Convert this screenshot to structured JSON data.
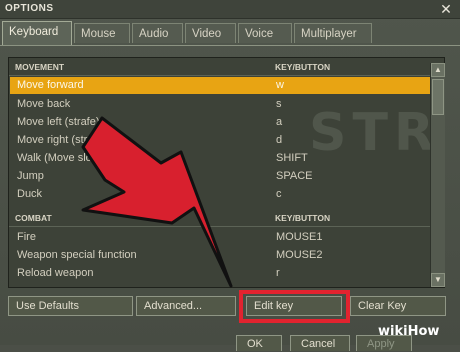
{
  "window": {
    "title": "OPTIONS",
    "close_glyph": "✕"
  },
  "tabs": [
    {
      "label": "Keyboard",
      "active": true
    },
    {
      "label": "Mouse"
    },
    {
      "label": "Audio"
    },
    {
      "label": "Video"
    },
    {
      "label": "Voice"
    },
    {
      "label": "Multiplayer"
    }
  ],
  "background_logo": "STRIK",
  "sections": {
    "movement": {
      "header_action": "MOVEMENT",
      "header_key": "KEY/BUTTON",
      "rows": [
        {
          "action": "Move forward",
          "key": "w",
          "selected": true
        },
        {
          "action": "Move back",
          "key": "s"
        },
        {
          "action": "Move left (strafe)",
          "key": "a"
        },
        {
          "action": "Move right (strafe)",
          "key": "d"
        },
        {
          "action": "Walk (Move slowly)",
          "key": "SHIFT"
        },
        {
          "action": "Jump",
          "key": "SPACE"
        },
        {
          "action": "Duck",
          "key": "c"
        }
      ]
    },
    "combat": {
      "header_action": "COMBAT",
      "header_key": "KEY/BUTTON",
      "rows": [
        {
          "action": "Fire",
          "key": "MOUSE1"
        },
        {
          "action": "Weapon special function",
          "key": "MOUSE2"
        },
        {
          "action": "Reload weapon",
          "key": "r"
        }
      ]
    }
  },
  "buttons": {
    "use_defaults": "Use Defaults",
    "advanced": "Advanced...",
    "edit_key": "Edit key",
    "clear_key": "Clear Key"
  },
  "footer_buttons": {
    "ok": "OK",
    "cancel": "Cancel",
    "apply": "Apply"
  },
  "watermark": {
    "wiki": "wiki",
    "how": "How"
  },
  "colors": {
    "selection": "#e8a413",
    "highlight_box": "#e2232f",
    "arrow": "#d8202e"
  },
  "icons": {
    "scroll_up": "scroll-up-arrow-icon",
    "scroll_down": "scroll-down-arrow-icon"
  }
}
